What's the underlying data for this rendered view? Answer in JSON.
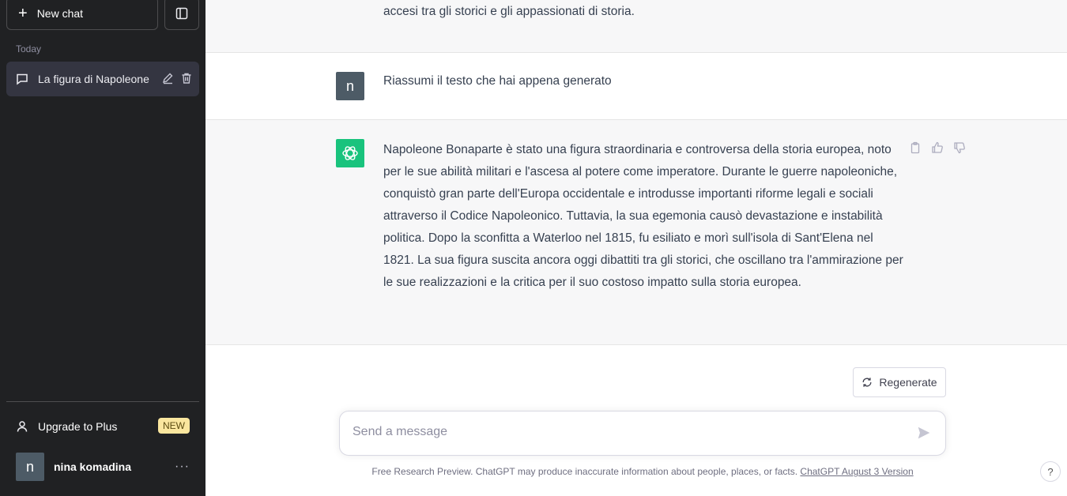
{
  "sidebar": {
    "new_chat_label": "New chat",
    "section_label": "Today",
    "chat_items": [
      {
        "title": "La figura di Napoleone"
      }
    ],
    "upgrade_label": "Upgrade to Plus",
    "upgrade_badge": "NEW",
    "user": {
      "initial": "n",
      "name": "nina komadina",
      "more": "···"
    }
  },
  "conversation": {
    "previous_tail": "accesi tra gli storici e gli appassionati di storia.",
    "user_message": {
      "avatar": "n",
      "text": "Riassumi il testo che hai appena generato"
    },
    "assistant_message": {
      "text": "Napoleone Bonaparte è stato una figura straordinaria e controversa della storia europea, noto per le sue abilità militari e l'ascesa al potere come imperatore. Durante le guerre napoleoniche, conquistò gran parte dell'Europa occidentale e introdusse importanti riforme legali e sociali attraverso il Codice Napoleonico. Tuttavia, la sua egemonia causò devastazione e instabilità politica. Dopo la sconfitta a Waterloo nel 1815, fu esiliato e morì sull'isola di Sant'Elena nel 1821. La sua figura suscita ancora oggi dibattiti tra gli storici, che oscillano tra l'ammirazione per le sue realizzazioni e la critica per il suo costoso impatto sulla storia europea."
    }
  },
  "composer": {
    "regenerate_label": "Regenerate",
    "placeholder": "Send a message"
  },
  "footer": {
    "text": "Free Research Preview. ChatGPT may produce inaccurate information about people, places, or facts. ",
    "link": "ChatGPT August 3 Version"
  },
  "help_label": "?",
  "colors": {
    "sidebar_bg": "#202123",
    "accent_green": "#19c37d",
    "badge_bg": "#fae69e",
    "user_avatar_bg": "#4d5b66"
  }
}
